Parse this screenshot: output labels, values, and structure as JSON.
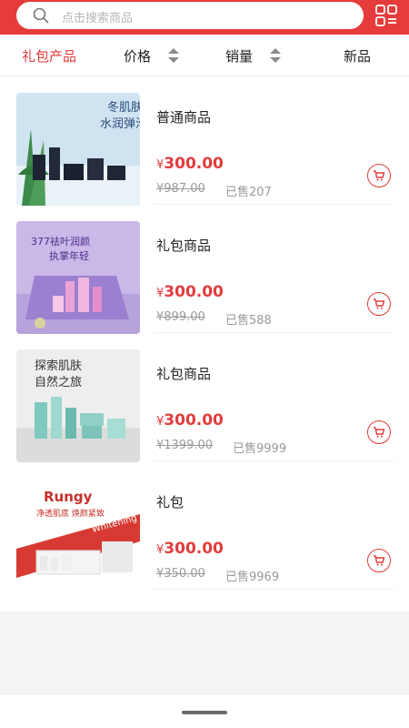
{
  "search": {
    "placeholder": "点击搜索商品"
  },
  "tabs": [
    {
      "label": "礼包产品"
    },
    {
      "label": "价格"
    },
    {
      "label": "销量"
    },
    {
      "label": "新品"
    }
  ],
  "products": [
    {
      "title": "普通商品",
      "price_symbol": "¥",
      "price": "300.00",
      "original": "¥987.00",
      "sold": "已售207",
      "image_text": [
        "冬肌肤",
        "水润弹滑"
      ]
    },
    {
      "title": "礼包商品",
      "price_symbol": "¥",
      "price": "300.00",
      "original": "¥899.00",
      "sold": "已售588",
      "image_text": [
        "377袪叶润颜",
        "执掌年轻"
      ]
    },
    {
      "title": "礼包商品",
      "price_symbol": "¥",
      "price": "300.00",
      "original": "¥1399.00",
      "sold": "已售9999",
      "image_text": [
        "探索肌肤",
        "自然之旅"
      ]
    },
    {
      "title": "礼包",
      "price_symbol": "¥",
      "price": "300.00",
      "original": "¥350.00",
      "sold": "已售9969",
      "image_text": [
        "Rungy",
        "净透肌底 焕颜紧致",
        "Whitening"
      ]
    }
  ],
  "colors": {
    "accent": "#e53b3b",
    "price": "#e23c3c"
  },
  "icons": [
    "search-icon",
    "grid-menu-icon",
    "sort-icon",
    "cart-icon"
  ]
}
